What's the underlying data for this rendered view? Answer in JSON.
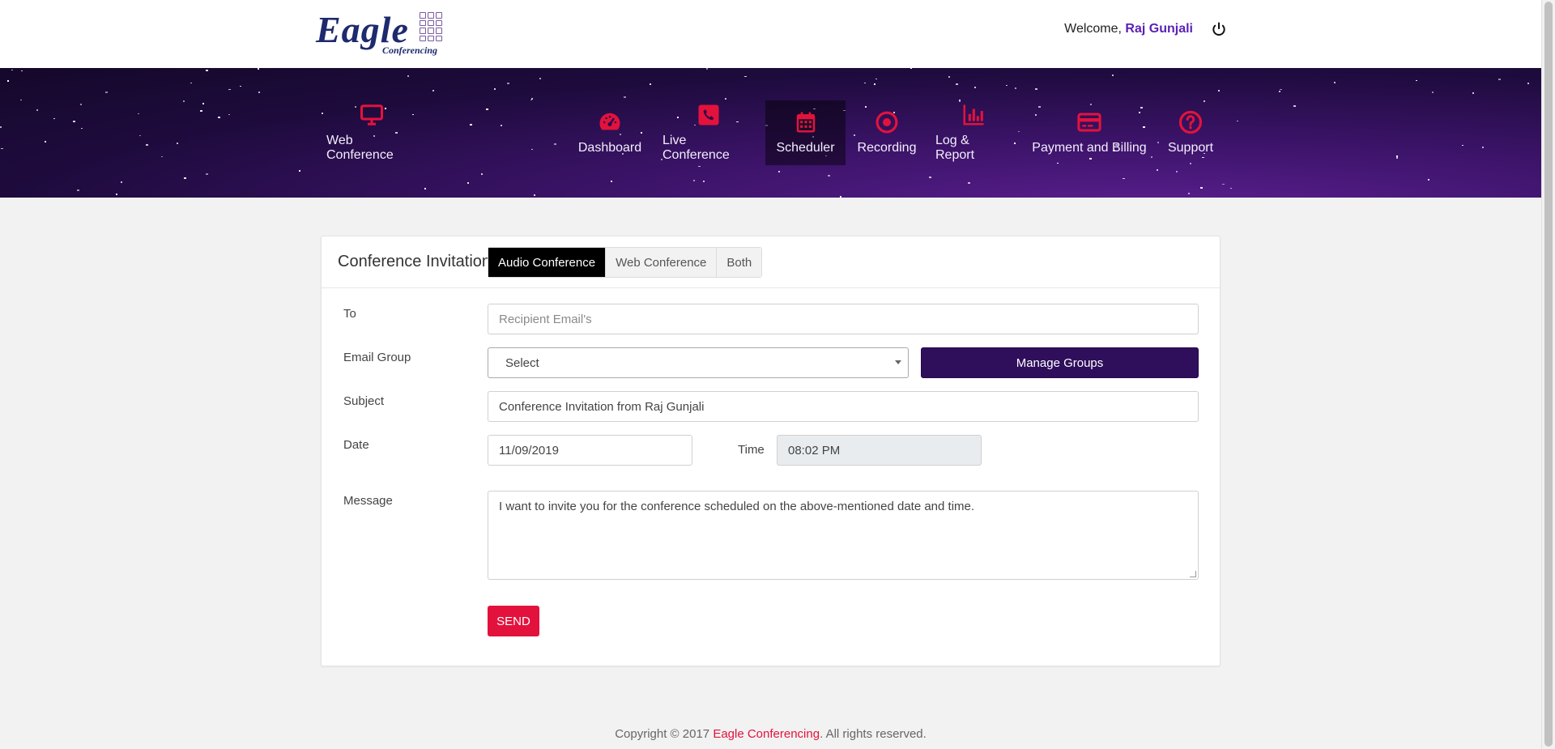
{
  "header": {
    "logo": {
      "word": "Eagle",
      "sub": "Conferencing"
    },
    "welcome_prefix": "Welcome,",
    "user_name": "Raj Gunjali",
    "power_icon": "power-icon"
  },
  "nav": {
    "brand_item": {
      "label": "Web Conference",
      "icon": "monitor-icon"
    },
    "items": [
      {
        "label": "Dashboard",
        "icon": "gauge-icon",
        "active": false
      },
      {
        "label": "Live Conference",
        "icon": "phone-icon",
        "active": false
      },
      {
        "label": "Scheduler",
        "icon": "calendar-icon",
        "active": true
      },
      {
        "label": "Recording",
        "icon": "record-icon",
        "active": false
      },
      {
        "label": "Log & Report",
        "icon": "bar-chart-icon",
        "active": false
      },
      {
        "label": "Payment and Billing",
        "icon": "credit-card-icon",
        "active": false
      },
      {
        "label": "Support",
        "icon": "help-icon",
        "active": false
      }
    ],
    "icon_color": "#e3123c"
  },
  "invitation": {
    "title": "Conference Invitation",
    "tabs": [
      "Audio Conference",
      "Web Conference",
      "Both"
    ],
    "active_tab": "Audio Conference",
    "to": {
      "label": "To",
      "placeholder": "Recipient  Email's",
      "value": ""
    },
    "email_group": {
      "label": "Email Group",
      "selected": "Select"
    },
    "manage_groups_label": "Manage Groups",
    "subject": {
      "label": "Subject",
      "value": "Conference Invitation from Raj Gunjali"
    },
    "date": {
      "label": "Date",
      "value": "11/09/2019"
    },
    "time": {
      "label": "Time",
      "value": "08:02 PM"
    },
    "message": {
      "label": "Message",
      "value": "I want to invite you for the conference scheduled on the above-mentioned date and time."
    },
    "send_label": "SEND"
  },
  "footer": {
    "prefix": "Copyright © 2017",
    "brand": "Eagle Conferencing",
    "suffix": ". All rights reserved."
  },
  "colors": {
    "accent": "#e3123c",
    "primary_dark": "#2f0e5c",
    "username": "#5b21b6"
  }
}
